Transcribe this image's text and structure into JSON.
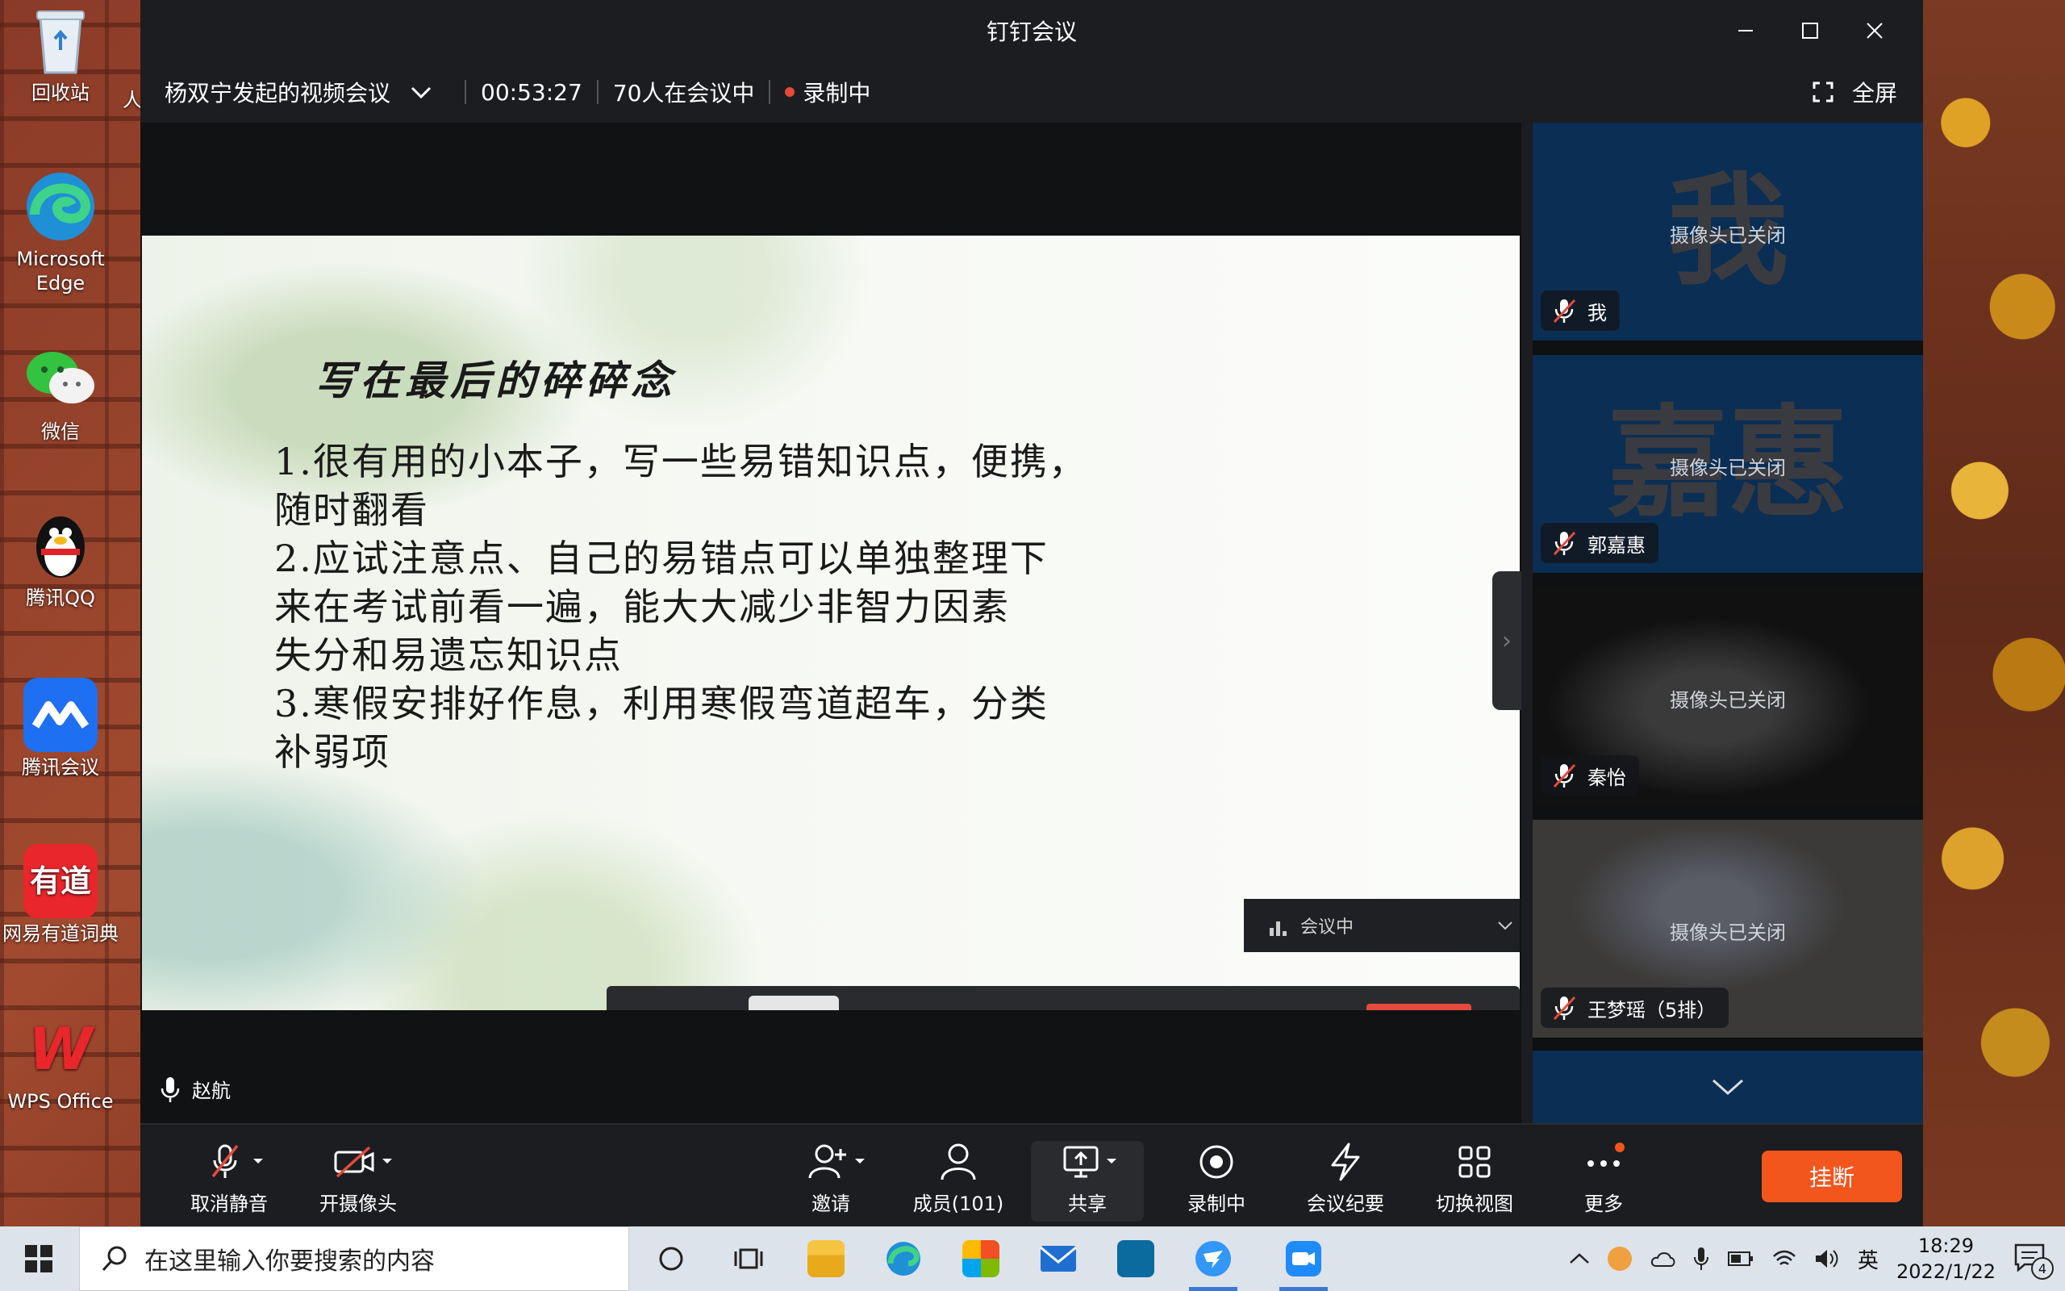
{
  "desktop": {
    "icons": [
      {
        "label": "回收站"
      },
      {
        "label": "Microsoft Edge"
      },
      {
        "label": "微信"
      },
      {
        "label": "腾讯QQ"
      },
      {
        "label": "腾讯会议"
      },
      {
        "label": "网易有道词典",
        "glyph": "有道"
      },
      {
        "label": "WPS Office",
        "glyph": "W"
      }
    ],
    "partial_label": "人"
  },
  "window": {
    "title": "钉钉会议",
    "meeting_name": "杨双宁发起的视频会议",
    "duration": "00:53:27",
    "participants_text": "70人在会议中",
    "recording_text": "录制中",
    "fullscreen_label": "全屏"
  },
  "slide": {
    "title": "写在最后的碎碎念",
    "lines": [
      "1.很有用的小本子，写一些易错知识点，便携，",
      "随时翻看",
      "2.应试注意点、自己的易错点可以单独整理下",
      "来在考试前看一遍，能大大减少非智力因素",
      "失分和易遗忘知识点",
      "3.寒假安排好作息，利用寒假弯道超车，分类",
      "补弱项"
    ],
    "overlay_status": "会议中"
  },
  "speaker": {
    "name": "赵航"
  },
  "gallery": {
    "camera_off_text": "摄像头已关闭",
    "participants": [
      {
        "name": "我",
        "big": "我"
      },
      {
        "name": "郭嘉惠",
        "big": "嘉惠"
      },
      {
        "name": "秦怡",
        "big": ""
      },
      {
        "name": "王梦瑶（5排）",
        "big": ""
      }
    ]
  },
  "toolbar": {
    "unmute": "取消静音",
    "camera": "开摄像头",
    "invite": "邀请",
    "members": "成员(101)",
    "share": "共享",
    "recording": "录制中",
    "minutes": "会议纪要",
    "switch_view": "切换视图",
    "more": "更多",
    "hangup": "挂断"
  },
  "taskbar": {
    "search_placeholder": "在这里输入你要搜索的内容",
    "ime": "英",
    "time": "18:29",
    "date": "2022/1/22",
    "notification_count": "4"
  },
  "colors": {
    "accent_orange": "#f2561d",
    "tile_blue": "#0b2e54",
    "record_red": "#e54b3c"
  }
}
